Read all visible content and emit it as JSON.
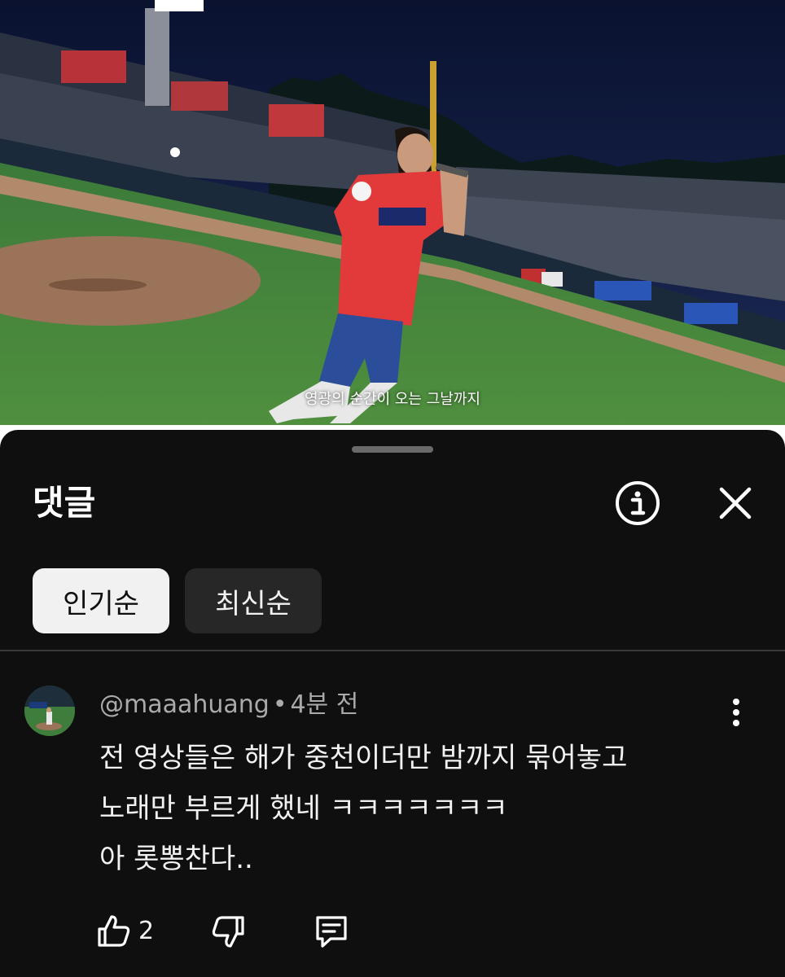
{
  "video": {
    "subtitle": "영광의 순간이 오는 그날까지"
  },
  "comments_panel": {
    "title": "댓글",
    "info_icon": "info-icon",
    "close_icon": "close-icon",
    "sort_chips": [
      {
        "label": "인기순",
        "selected": true
      },
      {
        "label": "최신순",
        "selected": false
      }
    ]
  },
  "comment": {
    "author": "@maaahuang",
    "separator": "•",
    "time": "4분 전",
    "lines": [
      "전 영상들은 해가 중천이더만 밤까지 묶어놓고",
      "노래만 부르게 했네 ㅋㅋㅋㅋㅋㅋㅋ",
      "아 롯뽕찬다.."
    ],
    "like_count": "2"
  },
  "colors": {
    "panel_bg": "#0f0f0f",
    "chip_selected_bg": "#f1f1f1",
    "chip_bg": "#272727",
    "text_primary": "#f1f1f1",
    "text_secondary": "#aaaaaa"
  }
}
